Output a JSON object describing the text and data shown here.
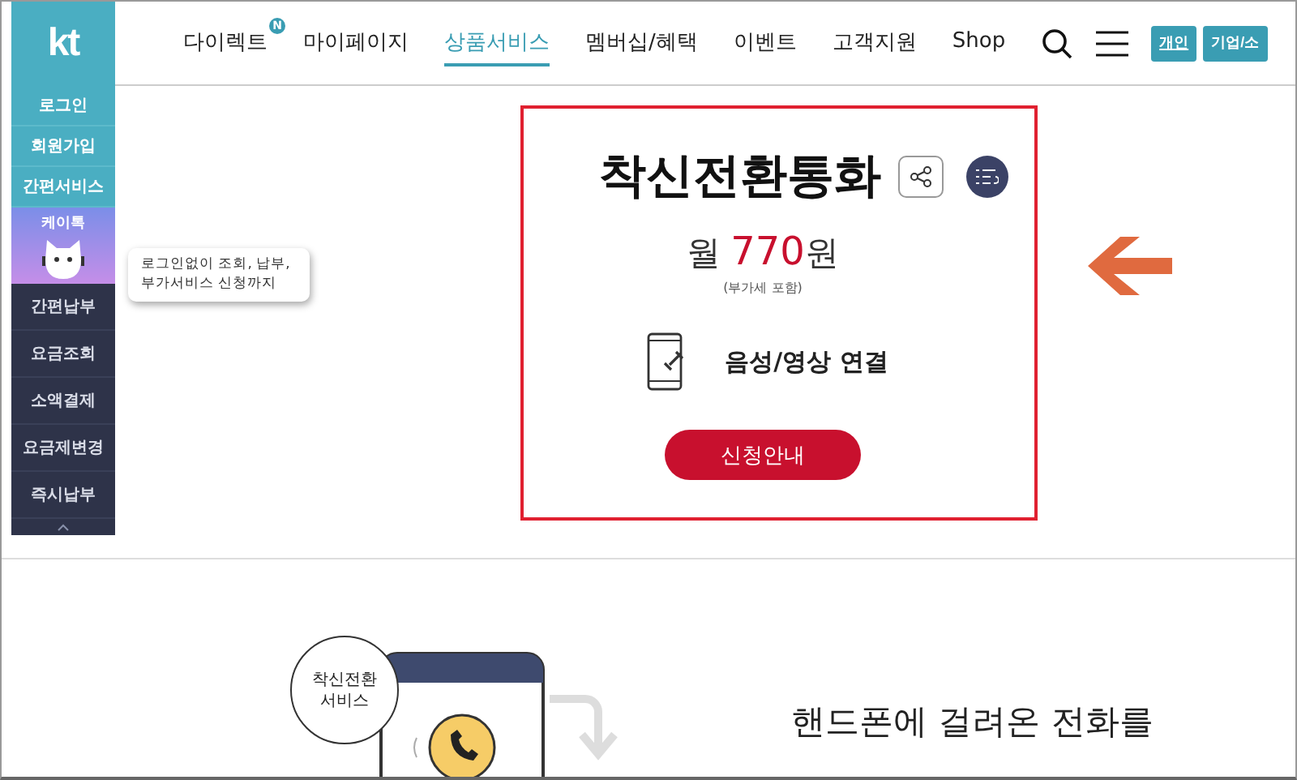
{
  "logo": "kt",
  "nav": [
    {
      "label": "다이렉트",
      "badge": "N",
      "selected": false
    },
    {
      "label": "마이페이지",
      "selected": false
    },
    {
      "label": "상품서비스",
      "selected": true
    },
    {
      "label": "멤버십/혜택",
      "selected": false
    },
    {
      "label": "이벤트",
      "selected": false
    },
    {
      "label": "고객지원",
      "selected": false
    },
    {
      "label": "Shop",
      "selected": false
    }
  ],
  "segments": [
    {
      "label": "개인",
      "selected": true
    },
    {
      "label": "기업/소",
      "selected": false
    }
  ],
  "sidebar": [
    {
      "kind": "light",
      "label": "로그인"
    },
    {
      "kind": "light",
      "label": "회원가입"
    },
    {
      "kind": "light",
      "label": "간편서비스"
    },
    {
      "kind": "character",
      "label": "케이톡"
    },
    {
      "kind": "dark",
      "label": "간편납부"
    },
    {
      "kind": "dark",
      "label": "요금조회"
    },
    {
      "kind": "dark",
      "label": "소액결제"
    },
    {
      "kind": "dark",
      "label": "요금제변경"
    },
    {
      "kind": "dark",
      "label": "즉시납부"
    }
  ],
  "tooltip": "로그인없이 조회, 납부,\n부가서비스 신청까지",
  "product": {
    "title": "착신전환통화",
    "price_prefix": "월",
    "price": "770",
    "price_suffix": "원",
    "vat_note": "(부가세 포함)",
    "feature": "음성/영상 연결",
    "button": "신청안내"
  },
  "illustration": {
    "bubble": "착신전환\n서비스",
    "headline": "핸드폰에 걸려온 전화를"
  }
}
